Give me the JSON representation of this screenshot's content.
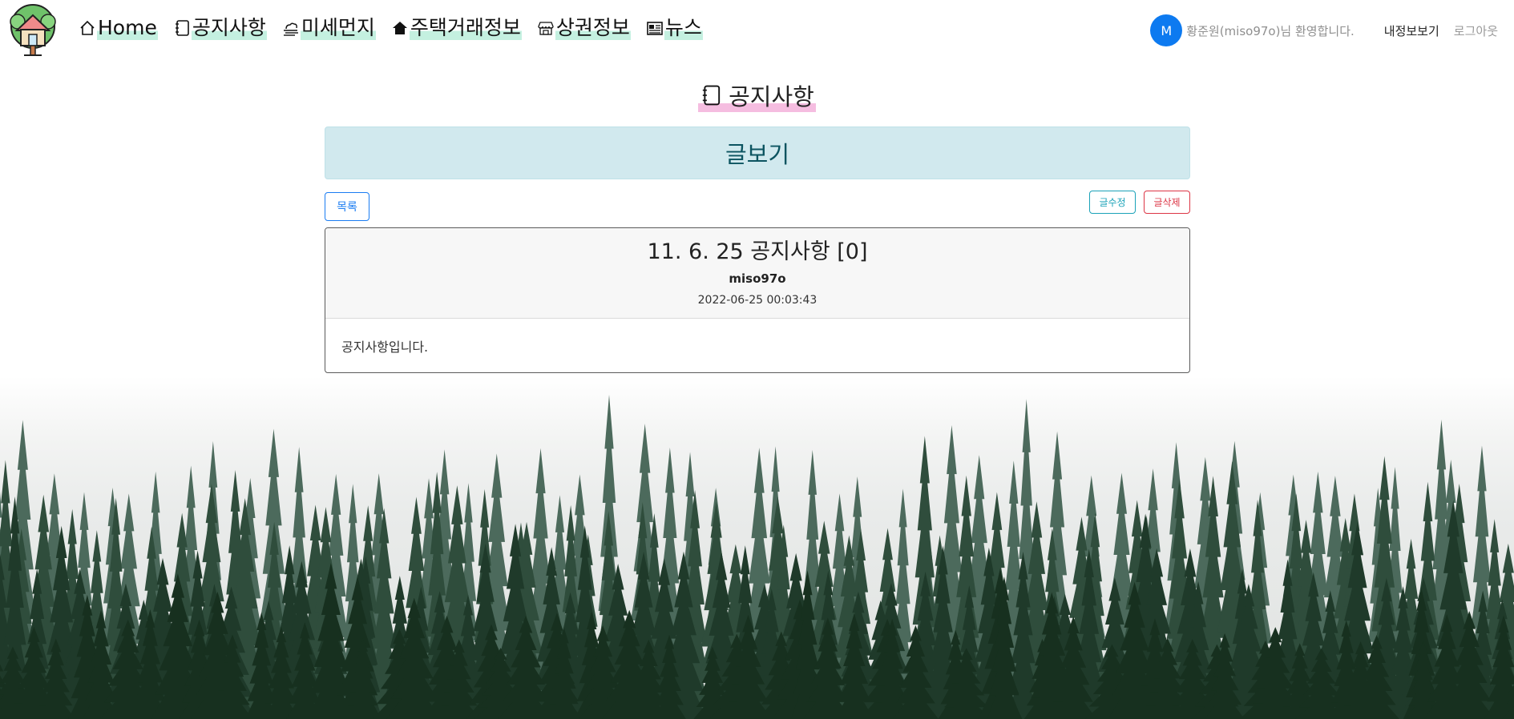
{
  "nav": {
    "items": [
      {
        "label": "Home",
        "icon": "house-icon"
      },
      {
        "label": "공지사항",
        "icon": "notebook-icon"
      },
      {
        "label": "미세먼지",
        "icon": "smog-icon"
      },
      {
        "label": "주택거래정보",
        "icon": "home-fill-icon"
      },
      {
        "label": "상권정보",
        "icon": "shop-icon"
      },
      {
        "label": "뉴스",
        "icon": "newspaper-icon"
      }
    ]
  },
  "user": {
    "avatar_initial": "M",
    "welcome": "황준원(miso97o)님 환영합니다.",
    "mypage_label": "내정보보기",
    "logout_label": "로그아웃"
  },
  "page": {
    "title": "공지사항",
    "section_header": "글보기"
  },
  "buttons": {
    "list": "목록",
    "edit": "글수정",
    "delete": "글삭제"
  },
  "post": {
    "title": "11. 6. 25 공지사항 [0]",
    "author": "miso97o",
    "date": "2022-06-25 00:03:43",
    "content": "공지사항입니다."
  },
  "colors": {
    "primary": "#1a7cf2",
    "info": "#1aa2b8",
    "danger": "#dc3545",
    "alert_bg": "#d1e9ee",
    "nav_highlight": "#c4f0e0",
    "title_highlight": "#f5bde0"
  }
}
